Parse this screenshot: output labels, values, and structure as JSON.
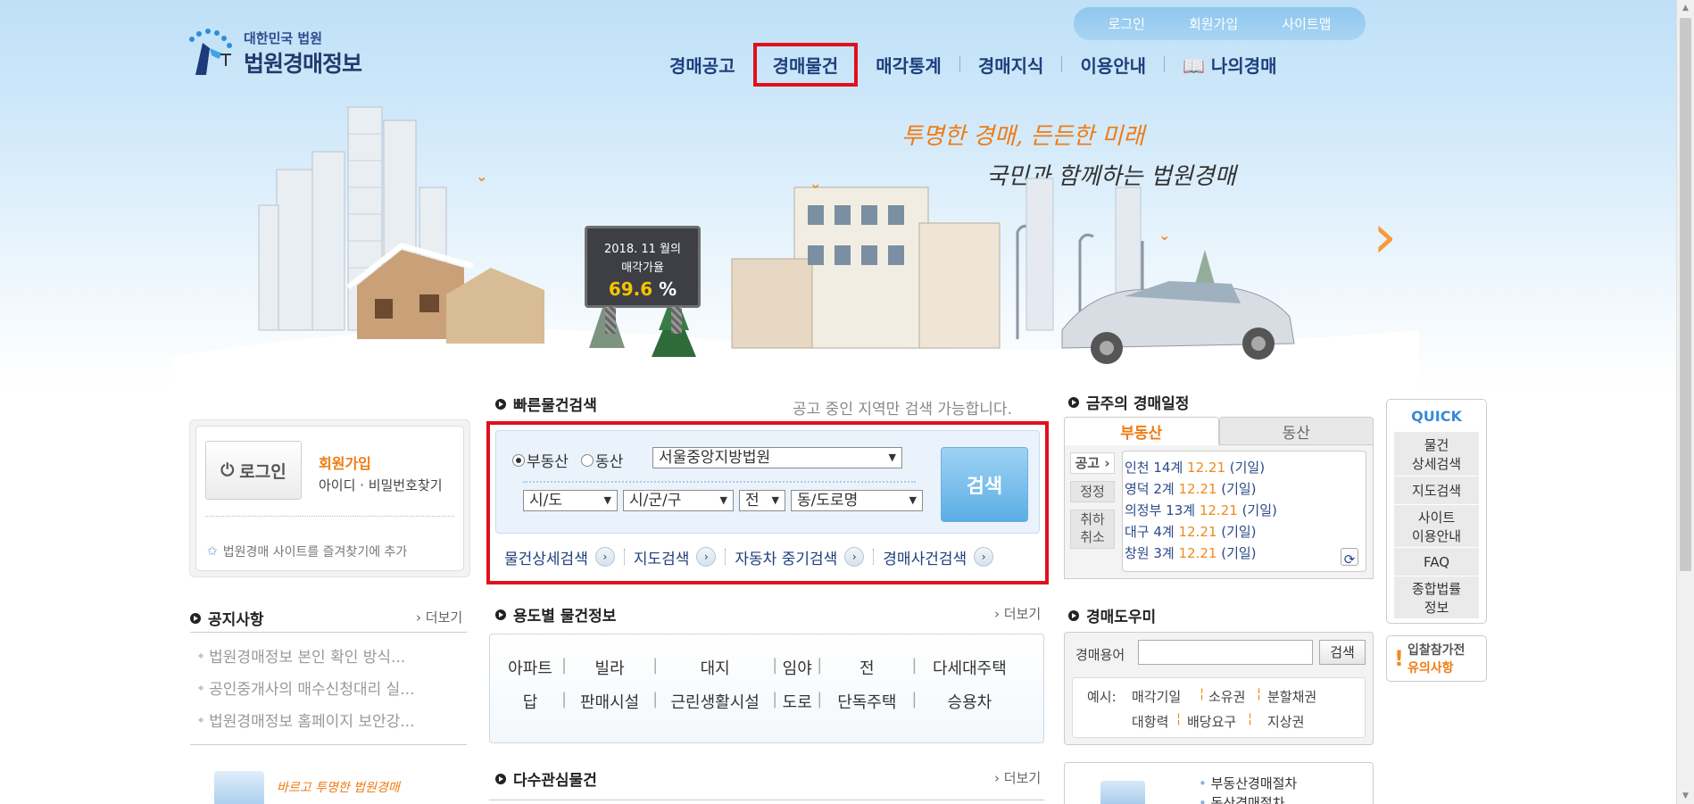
{
  "header": {
    "logo_small": "대한민국 법원",
    "logo_big": "법원경매정보",
    "util": [
      "로그인",
      "회원가입",
      "사이트맵"
    ],
    "nav": [
      "경매공고",
      "경매물건",
      "매각통계",
      "경매지식",
      "이용안내",
      "나의경매"
    ]
  },
  "banner": {
    "slogan1": "투명한 경매, 든든한 미래",
    "slogan2": "국민과 함께하는 법원경매",
    "billboard_line1": "2018. 11 월의",
    "billboard_line2": "매각가율",
    "billboard_value": "69.6",
    "billboard_unit": "%"
  },
  "login": {
    "button": "로그인",
    "join": "회원가입",
    "find": "아이디 · 비밀번호찾기",
    "favorite": "법원경매 사이트를 즐겨찾기에 추가"
  },
  "quick_search": {
    "title": "빠른물건검색",
    "note": "공고 중인 지역만 검색 가능합니다.",
    "radio_realestate": "부동산",
    "radio_movable": "동산",
    "court": "서울중앙지방법원",
    "sido": "시/도",
    "sigungu": "시/군/구",
    "all": "전",
    "dong": "동/도로명",
    "search_button": "검색",
    "links": [
      "물건상세검색",
      "지도검색",
      "자동차 중기검색",
      "경매사건검색"
    ]
  },
  "schedule": {
    "title": "금주의 경매일정",
    "tab_realestate": "부동산",
    "tab_movable": "동산",
    "side": [
      "공고",
      "정정",
      "취하\n취소"
    ],
    "items": [
      {
        "court": "인천 14계",
        "date": "12.21",
        "type": "(기일)"
      },
      {
        "court": "영덕 2계",
        "date": "12.21",
        "type": "(기일)"
      },
      {
        "court": "의정부 13계",
        "date": "12.21",
        "type": "(기일)"
      },
      {
        "court": "대구 4계",
        "date": "12.21",
        "type": "(기일)"
      },
      {
        "court": "창원 3계",
        "date": "12.21",
        "type": "(기일)"
      }
    ]
  },
  "quick_menu": {
    "title": "QUICK",
    "items": [
      "물건\n상세검색",
      "지도검색",
      "사이트\n이용안내",
      "FAQ",
      "종합법률\n정보"
    ],
    "notice_line1": "입찰참가전",
    "notice_line2": "유의사항"
  },
  "notice": {
    "title": "공지사항",
    "more": "더보기",
    "items": [
      "법원경매정보 본인 확인 방식...",
      "공인중개사의 매수신청대리 실...",
      "법원경매정보 홈페이지 보안강..."
    ]
  },
  "usage": {
    "title": "용도별 물건정보",
    "more": "더보기",
    "row1": [
      "아파트",
      "빌라",
      "대지",
      "임야",
      "전",
      "다세대주택"
    ],
    "row2": [
      "답",
      "판매시설",
      "근린생활시설",
      "도로",
      "단독주택",
      "승용차"
    ]
  },
  "helper": {
    "title": "경매도우미",
    "label": "경매용어",
    "button": "검색",
    "example_label": "예시:",
    "examples_row1": [
      "매각기일",
      "소유권",
      "분할채권"
    ],
    "examples_row2": [
      "대항력",
      "배당요구",
      "지상권"
    ]
  },
  "popular": {
    "title": "다수관심물건",
    "more": "더보기"
  },
  "bottom_links": [
    "부동산경매절차",
    "동산경매절차"
  ],
  "promo_text": "바르고 투명한 법원경매"
}
